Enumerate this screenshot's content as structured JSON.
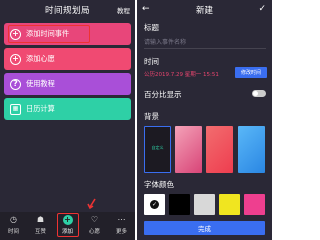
{
  "left": {
    "title": "时间规划局",
    "action": "教程",
    "cards": [
      {
        "label": "添加时间事件",
        "icon": "plus-icon",
        "color": "#e8467a"
      },
      {
        "label": "添加心愿",
        "icon": "plus-icon",
        "color": "#f04a72"
      },
      {
        "label": "使用教程",
        "icon": "help-icon",
        "color": "#a94fd8"
      },
      {
        "label": "日历计算",
        "icon": "calendar-icon",
        "color": "#2ed0a6"
      }
    ],
    "tabs": [
      {
        "label": "时间",
        "icon": "clock-icon"
      },
      {
        "label": "互赞",
        "icon": "thumb-icon"
      },
      {
        "label": "添加",
        "icon": "add-icon"
      },
      {
        "label": "心愿",
        "icon": "heart-icon"
      },
      {
        "label": "更多",
        "icon": "more-icon"
      }
    ]
  },
  "right": {
    "title": "新建",
    "title_field": {
      "label": "标题",
      "placeholder": "请输入事件名称"
    },
    "time": {
      "label": "时间",
      "value": "公历2019.7.29 星期一 15:51",
      "edit_label": "修改时间"
    },
    "percent": {
      "label": "百分比显示",
      "enabled": false
    },
    "background": {
      "label": "背景",
      "default_label": "自定义"
    },
    "font_color": {
      "label": "字体颜色",
      "options": [
        "#ffffff",
        "#000000",
        "#d8d8d8",
        "#f0e520",
        "#ee3f8f"
      ],
      "selected": 0
    },
    "done_label": "完成"
  },
  "colors": {
    "panel_bg": "#2a2836",
    "accent": "#3a6ef0",
    "highlight": "#e33333",
    "date": "#e9456f"
  }
}
